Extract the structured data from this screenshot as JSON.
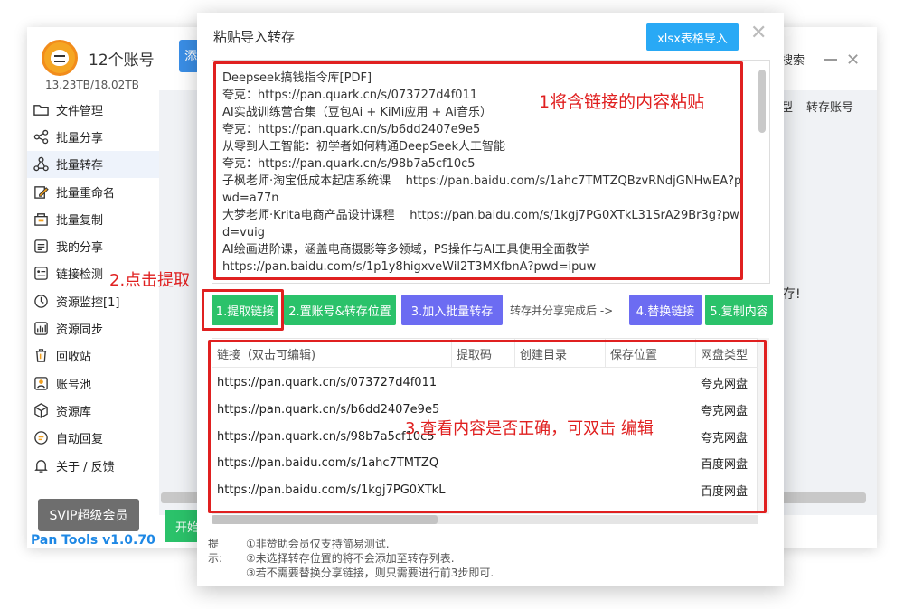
{
  "app": {
    "account_title": "12个账号",
    "storage": "13.23TB/18.02TB",
    "add_button": "添加",
    "search_label": "搜索",
    "col_partial": "型",
    "col_save_account": "转存账号",
    "done_text": "存!",
    "start_button": "开始",
    "svip_button": "SVIP超级会员",
    "version": "Pan Tools v1.0.70"
  },
  "sidebar": {
    "items": [
      {
        "label": "文件管理",
        "icon": "folder-icon"
      },
      {
        "label": "批量分享",
        "icon": "share-icon"
      },
      {
        "label": "批量转存",
        "icon": "transfer-icon"
      },
      {
        "label": "批量重命名",
        "icon": "rename-icon"
      },
      {
        "label": "批量复制",
        "icon": "copy-icon"
      },
      {
        "label": "我的分享",
        "icon": "my-share-icon"
      },
      {
        "label": "链接检测",
        "icon": "link-check-icon"
      },
      {
        "label": "资源监控[1]",
        "icon": "monitor-icon"
      },
      {
        "label": "资源同步",
        "icon": "sync-icon"
      },
      {
        "label": "回收站",
        "icon": "trash-icon"
      },
      {
        "label": "账号池",
        "icon": "account-pool-icon"
      },
      {
        "label": "资源库",
        "icon": "cube-icon"
      },
      {
        "label": "自动回复",
        "icon": "auto-reply-icon"
      },
      {
        "label": "关于 / 反馈",
        "icon": "bell-icon"
      }
    ]
  },
  "dialog": {
    "title": "粘贴导入转存",
    "xlsx_button": "xlsx表格导入",
    "paste_content": "Deepseek搞钱指令库[PDF]\n夸克：https://pan.quark.cn/s/073727d4f011\nAI实战训练营合集（豆包Ai + KiMi应用 + Ai音乐）\n夸克：https://pan.quark.cn/s/b6dd2407e9e5\n从零到人工智能：初学者如何精通DeepSeek人工智能\n夸克：https://pan.quark.cn/s/98b7a5cf10c5\n子枫老师·淘宝低成本起店系统课    https://pan.baidu.com/s/1ahc7TMTZQBzvRNdjGNHwEA?pwd=a77n\n大梦老师·Krita电商产品设计课程    https://pan.baidu.com/s/1kgj7PG0XTkL31SrA29Br3g?pwd=vuig\nAI绘画进阶课，涵盖电商摄影等多领域，PS操作与AI工具使用全面教学\nhttps://pan.baidu.com/s/1p1y8higxveWil2T3MXfbnA?pwd=ipuw",
    "buttons": {
      "extract": "1.提取链接",
      "set_account": "2.置账号&转存位置",
      "add_batch": "3.加入批量转存",
      "arrow_text": "转存并分享完成后 ->",
      "replace": "4.替换链接",
      "copy": "5.复制内容"
    },
    "table": {
      "headers": [
        "链接（双击可编辑)",
        "提取码",
        "创建目录",
        "保存位置",
        "网盘类型"
      ],
      "rows": [
        {
          "link": "https://pan.quark.cn/s/073727d4f011",
          "type": "夸克网盘"
        },
        {
          "link": "https://pan.quark.cn/s/b6dd2407e9e5",
          "type": "夸克网盘"
        },
        {
          "link": "https://pan.quark.cn/s/98b7a5cf10c5",
          "type": "夸克网盘"
        },
        {
          "link": "https://pan.baidu.com/s/1ahc7TMTZQ",
          "type": "百度网盘"
        },
        {
          "link": "https://pan.baidu.com/s/1kgj7PG0XTkL",
          "type": "百度网盘"
        }
      ]
    },
    "tips": {
      "label": "提示:",
      "lines": [
        "①非赞助会员仅支持简易测试.",
        "②未选择转存位置的将不会添加至转存列表.",
        "③若不需要替换分享链接，则只需要进行前3步即可."
      ]
    }
  },
  "annotations": {
    "step1": "1将含链接的内容粘贴",
    "step2": "2.点击提取",
    "step3": "3.查看内容是否正确，可双击 编辑"
  },
  "colors": {
    "annotation_red": "#e02020",
    "primary_blue": "#29a9f5",
    "action_green": "#2bc26a",
    "action_purple": "#6c6cf2",
    "version_blue": "#1e88e5"
  }
}
